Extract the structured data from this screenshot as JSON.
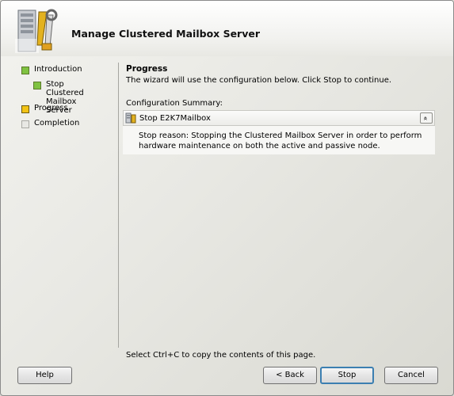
{
  "header": {
    "title": "Manage Clustered Mailbox Server"
  },
  "nav": {
    "items": [
      {
        "label": "Introduction",
        "state": "done"
      },
      {
        "label": "Stop Clustered Mailbox Server",
        "state": "done"
      },
      {
        "label": "Progress",
        "state": "current"
      },
      {
        "label": "Completion",
        "state": "pending"
      }
    ]
  },
  "content": {
    "section_title": "Progress",
    "description": "The wizard will use the configuration below.  Click Stop to continue.",
    "config_label": "Configuration Summary:",
    "summary": {
      "title": "Stop E2K7Mailbox",
      "collapse_symbol": "»",
      "detail": "Stop reason: Stopping the Clustered Mailbox Server in order to perform hardware maintenance on both the active and passive node."
    },
    "footer_hint": "Select Ctrl+C to copy the contents of this page."
  },
  "buttons": {
    "help": "Help",
    "back": "< Back",
    "stop": "Stop",
    "cancel": "Cancel"
  },
  "colors": {
    "step_done": "#7fc241",
    "step_current": "#f2c316",
    "step_pending": "#e8e8e4",
    "default_button_border": "#3c7fb1"
  }
}
